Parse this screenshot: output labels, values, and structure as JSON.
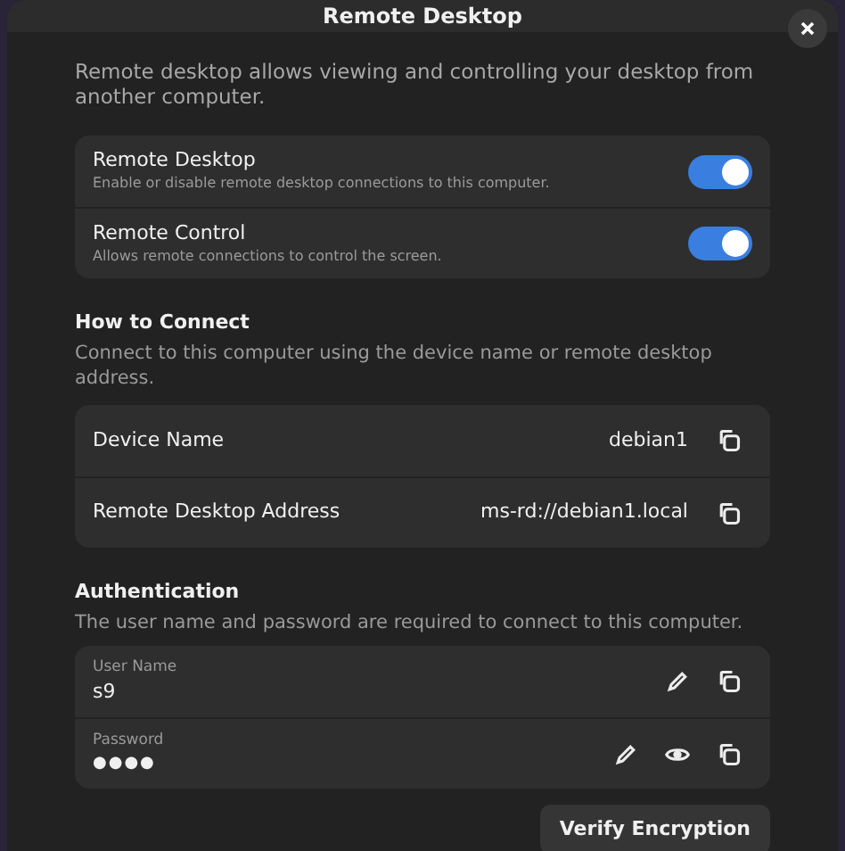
{
  "window": {
    "title": "Remote Desktop"
  },
  "description": "Remote desktop allows viewing and controlling your desktop from another computer.",
  "toggles": [
    {
      "title": "Remote Desktop",
      "subtitle": "Enable or disable remote desktop connections to this computer.",
      "on": true
    },
    {
      "title": "Remote Control",
      "subtitle": "Allows remote connections to control the screen.",
      "on": true
    }
  ],
  "how_to_connect": {
    "heading": "How to Connect",
    "subtitle": "Connect to this computer using the device name or remote desktop address.",
    "rows": [
      {
        "label": "Device Name",
        "value": "debian1"
      },
      {
        "label": "Remote Desktop Address",
        "value": "ms-rd://debian1.local"
      }
    ]
  },
  "authentication": {
    "heading": "Authentication",
    "subtitle": "The user name and password are required to connect to this computer.",
    "fields": [
      {
        "kind": "text",
        "label": "User Name",
        "value": "s9"
      },
      {
        "kind": "password",
        "label": "Password",
        "value": "●●●●"
      }
    ]
  },
  "button": "Verify Encryption"
}
